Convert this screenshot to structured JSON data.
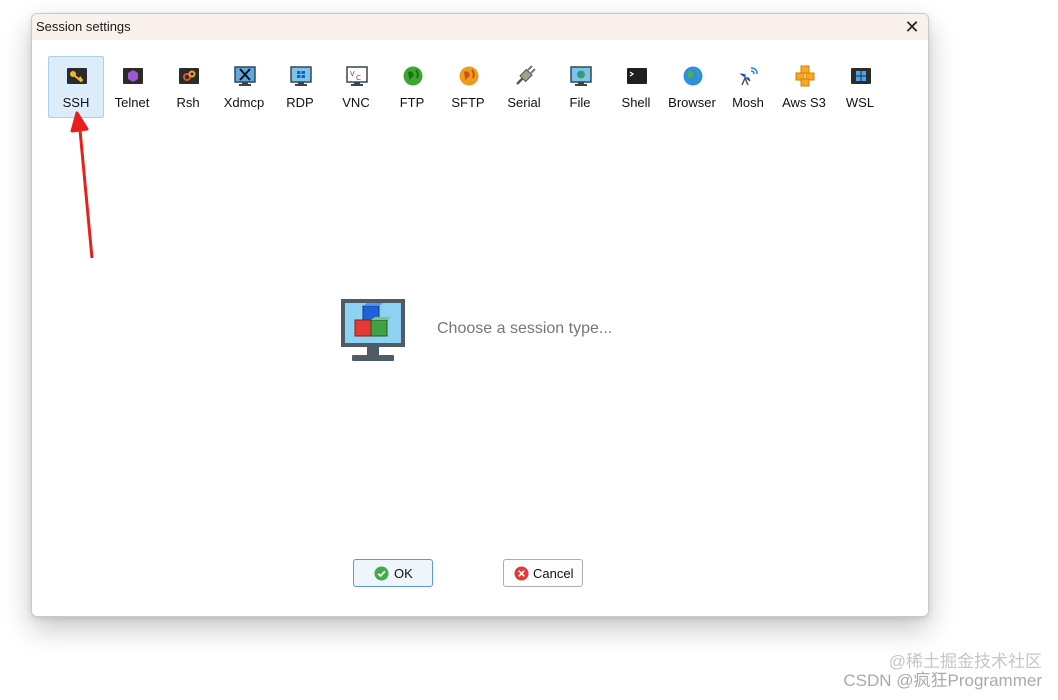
{
  "dialog": {
    "title": "Session settings",
    "close_glyph": "✕"
  },
  "session_types": [
    {
      "label": "SSH",
      "icon": "key-icon",
      "selected": true
    },
    {
      "label": "Telnet",
      "icon": "telnet-icon"
    },
    {
      "label": "Rsh",
      "icon": "rsh-icon"
    },
    {
      "label": "Xdmcp",
      "icon": "xdmcp-icon"
    },
    {
      "label": "RDP",
      "icon": "rdp-icon"
    },
    {
      "label": "VNC",
      "icon": "vnc-icon"
    },
    {
      "label": "FTP",
      "icon": "ftp-globe-icon"
    },
    {
      "label": "SFTP",
      "icon": "sftp-globe-icon"
    },
    {
      "label": "Serial",
      "icon": "serial-plug-icon"
    },
    {
      "label": "File",
      "icon": "file-monitor-icon"
    },
    {
      "label": "Shell",
      "icon": "shell-terminal-icon"
    },
    {
      "label": "Browser",
      "icon": "browser-globe-icon"
    },
    {
      "label": "Mosh",
      "icon": "mosh-satellite-icon"
    },
    {
      "label": "Aws S3",
      "icon": "aws-s3-cubes-icon"
    },
    {
      "label": "WSL",
      "icon": "wsl-windows-icon"
    }
  ],
  "placeholder": {
    "text": "Choose a session type...",
    "icon": "monitor-cubes-icon"
  },
  "buttons": {
    "ok_label": "OK",
    "cancel_label": "Cancel"
  },
  "watermark": {
    "line1": "@稀土掘金技术社区",
    "line2": "CSDN @疯狂Programmer"
  },
  "colors": {
    "selected_bg": "#dcecfb",
    "titlebar_bg": "#fbf1ec",
    "arrow": "#e8201c"
  }
}
